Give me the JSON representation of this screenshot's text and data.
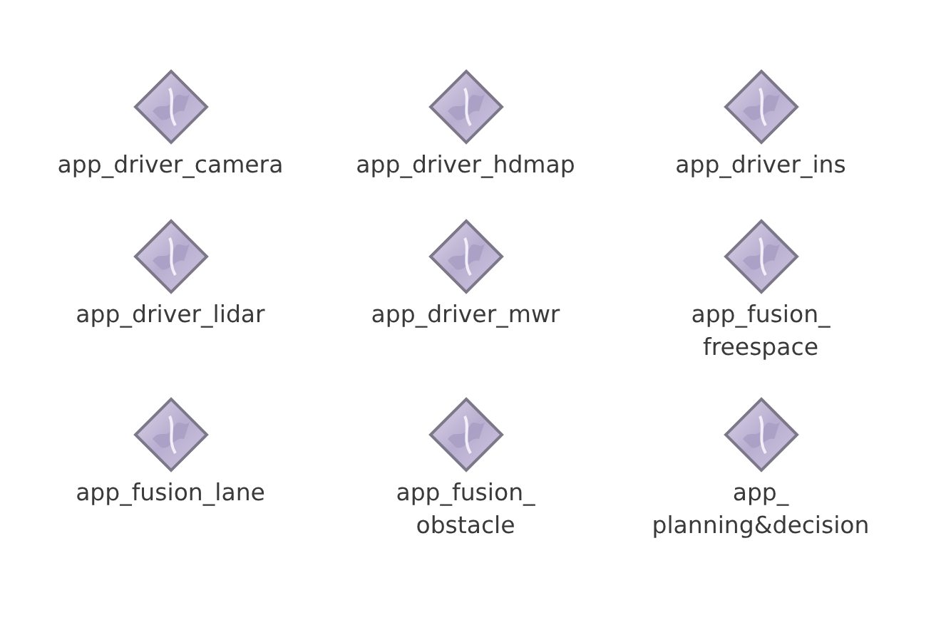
{
  "files": [
    {
      "label_lines": [
        "app_driver_camera"
      ]
    },
    {
      "label_lines": [
        "app_driver_hdmap"
      ]
    },
    {
      "label_lines": [
        "app_driver_ins"
      ]
    },
    {
      "label_lines": [
        "app_driver_lidar"
      ]
    },
    {
      "label_lines": [
        "app_driver_mwr"
      ]
    },
    {
      "label_lines": [
        "app_fusion_",
        "freespace"
      ]
    },
    {
      "label_lines": [
        "app_fusion_lane"
      ]
    },
    {
      "label_lines": [
        "app_fusion_",
        "obstacle"
      ]
    },
    {
      "label_lines": [
        "app_",
        "planning&decision"
      ]
    }
  ]
}
